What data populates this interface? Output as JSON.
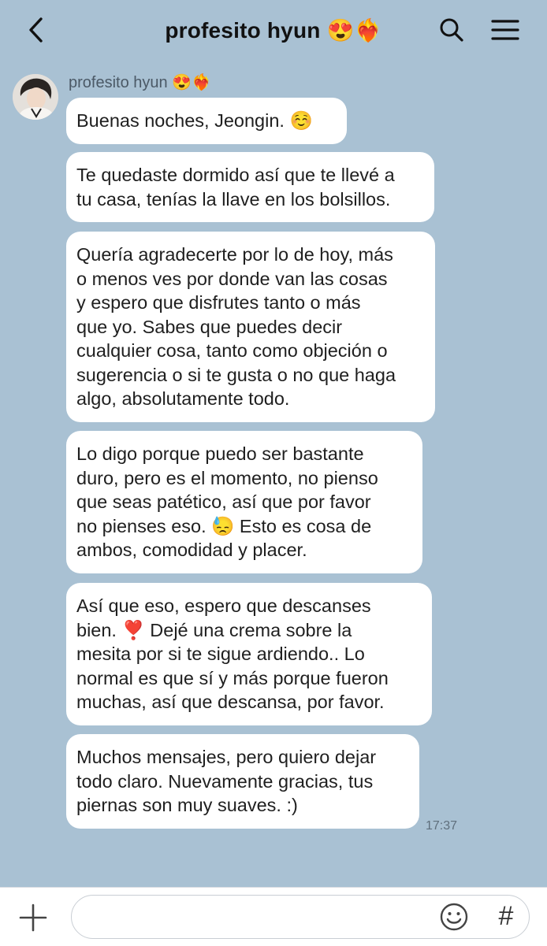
{
  "header": {
    "title": "profesito hyun 😍❤️‍🔥",
    "icons": {
      "back": "chevron-left-icon",
      "search": "search-icon",
      "menu": "hamburger-menu-icon"
    }
  },
  "chat": {
    "sender_name": "profesito hyun 😍❤️‍🔥",
    "messages": [
      "Buenas noches, Jeongin. ☺️",
      "Te quedaste dormido así que te llevé a\ntu casa, tenías la llave en los bolsillos.",
      "Quería agradecerte por lo de hoy, más\no menos ves por donde van las cosas\ny espero que disfrutes tanto o más\nque yo. Sabes que puedes decir\ncualquier cosa, tanto como objeción o\nsugerencia o si te gusta o no que haga\nalgo, absolutamente todo.",
      "Lo digo porque puedo ser bastante\nduro, pero es el momento, no pienso\nque seas patético, así que por favor\nno pienses eso. 😓 Esto es cosa de\nambos, comodidad y placer.",
      "Así que eso, espero que descanses\nbien. ❣️ Dejé una crema sobre la\nmesita por si te sigue ardiendo.. Lo\nnormal es que sí y más porque fueron\nmuchas, así que descansa, por favor.",
      "Muchos mensajes, pero quiero dejar\ntodo claro. Nuevamente gracias, tus\npiernas son muy suaves. :)"
    ],
    "last_time": "17:37"
  },
  "bottom": {
    "hash_label": "#",
    "icons": {
      "plus": "plus-icon",
      "emoji": "smiley-icon",
      "hash": "hashtag-icon"
    },
    "input_value": ""
  },
  "colors": {
    "background": "#a9c1d3",
    "bubble": "#ffffff",
    "bottom_bar": "#ffffff"
  }
}
